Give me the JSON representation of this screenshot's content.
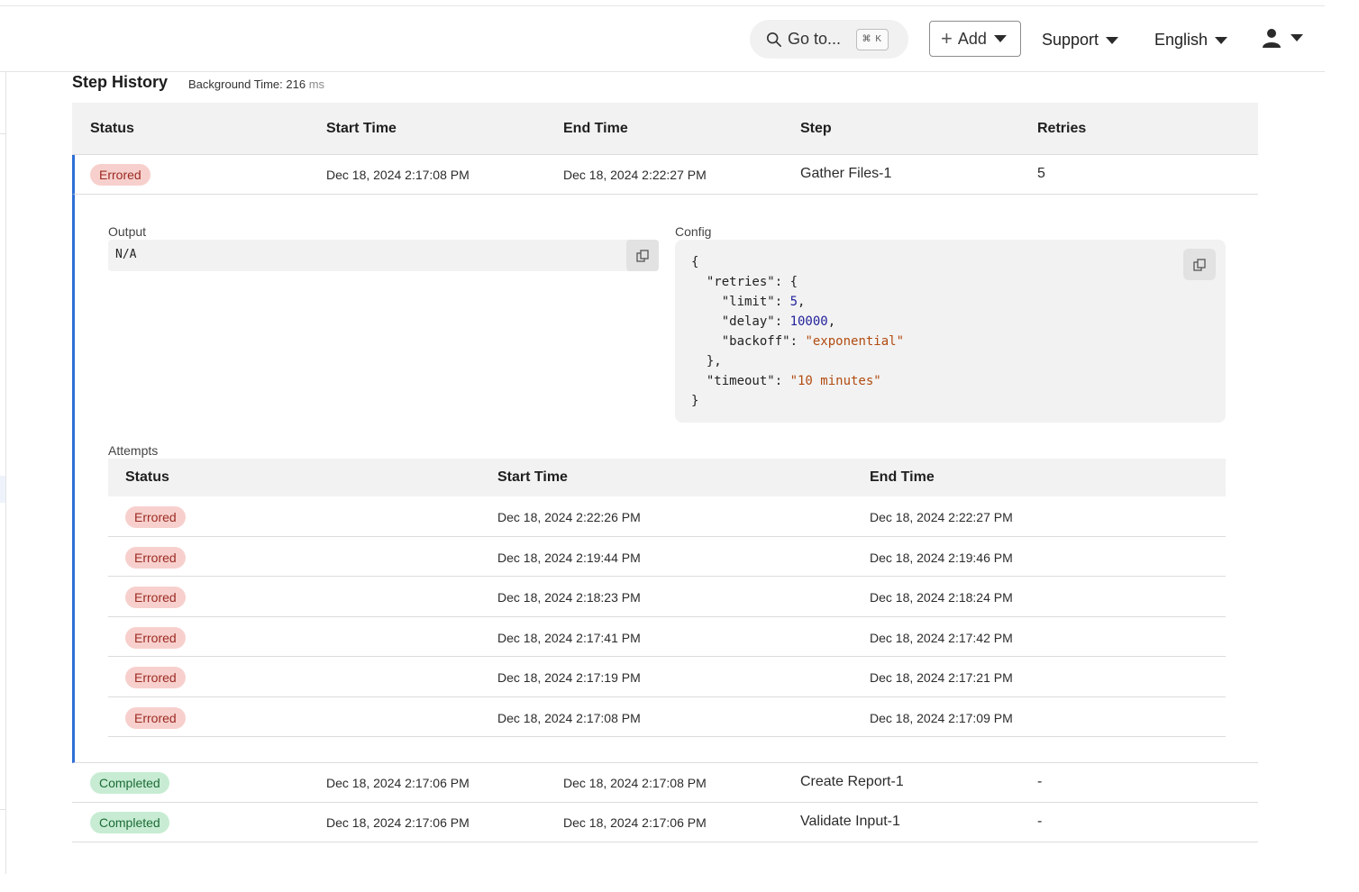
{
  "topbar": {
    "goto_label": "Go to...",
    "goto_shortcut": "⌘ K",
    "add_label": "Add",
    "support_label": "Support",
    "language_label": "English",
    "icons": {
      "search": "search-icon",
      "plus": "plus-icon",
      "user": "user-icon",
      "caret": "caret-down-icon"
    }
  },
  "heading": {
    "title": "Step History",
    "background_time_label": "Background Time: 216",
    "background_time_unit": "ms"
  },
  "table": {
    "headers": [
      "Status",
      "Start Time",
      "End Time",
      "Step",
      "Retries"
    ],
    "rows": [
      {
        "status": "Errored",
        "start": "Dec 18, 2024 2:17:08 PM",
        "end": "Dec 18, 2024 2:22:27 PM",
        "step": "Gather Files-1",
        "retries": "5"
      },
      {
        "status": "Completed",
        "start": "Dec 18, 2024 2:17:06 PM",
        "end": "Dec 18, 2024 2:17:08 PM",
        "step": "Create Report-1",
        "retries": "-"
      },
      {
        "status": "Completed",
        "start": "Dec 18, 2024 2:17:06 PM",
        "end": "Dec 18, 2024 2:17:06 PM",
        "step": "Validate Input-1",
        "retries": "-"
      }
    ]
  },
  "detail": {
    "output_label": "Output",
    "output_value": "N/A",
    "config_label": "Config",
    "config": {
      "open": "{",
      "retries_key": "  \"retries\": {",
      "limit_key": "    \"limit\": ",
      "limit_val": "5",
      "delay_key": "    \"delay\": ",
      "delay_val": "10000",
      "backoff_key": "    \"backoff\": ",
      "backoff_val": "\"exponential\"",
      "retries_close": "  },",
      "timeout_key": "  \"timeout\": ",
      "timeout_val": "\"10 minutes\"",
      "close": "}"
    },
    "attempts_label": "Attempts",
    "attempts_headers": [
      "Status",
      "Start Time",
      "End Time"
    ],
    "attempts": [
      {
        "status": "Errored",
        "start": "Dec 18, 2024 2:22:26 PM",
        "end": "Dec 18, 2024 2:22:27 PM"
      },
      {
        "status": "Errored",
        "start": "Dec 18, 2024 2:19:44 PM",
        "end": "Dec 18, 2024 2:19:46 PM"
      },
      {
        "status": "Errored",
        "start": "Dec 18, 2024 2:18:23 PM",
        "end": "Dec 18, 2024 2:18:24 PM"
      },
      {
        "status": "Errored",
        "start": "Dec 18, 2024 2:17:41 PM",
        "end": "Dec 18, 2024 2:17:42 PM"
      },
      {
        "status": "Errored",
        "start": "Dec 18, 2024 2:17:19 PM",
        "end": "Dec 18, 2024 2:17:21 PM"
      },
      {
        "status": "Errored",
        "start": "Dec 18, 2024 2:17:08 PM",
        "end": "Dec 18, 2024 2:17:09 PM"
      }
    ]
  },
  "colors": {
    "accent_border": "#2f6fd6",
    "errored_bg": "#f7d0cd",
    "completed_bg": "#c7ecd3"
  }
}
